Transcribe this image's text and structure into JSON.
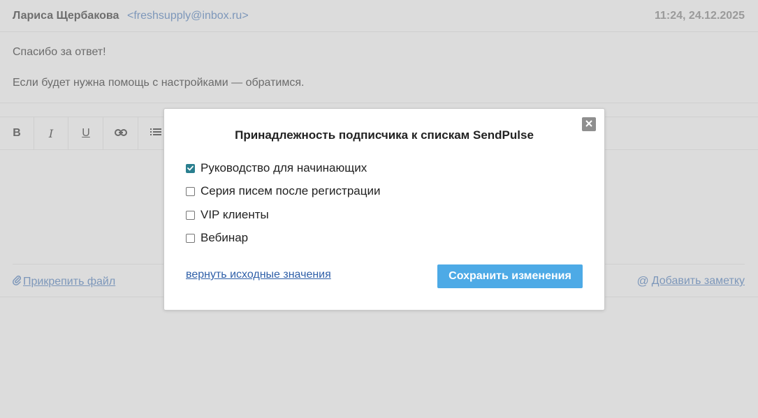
{
  "message": {
    "sender_name": "Лариса Щербакова",
    "sender_email": "<freshsupply@inbox.ru>",
    "datetime": "11:24, 24.12.2025",
    "body_lines": [
      "Спасибо за ответ!",
      "Если будет нужна помощь с настройками — обратимся."
    ]
  },
  "toolbar": {
    "bold": "B",
    "italic": "I",
    "underline": "U",
    "link_icon": "link-icon",
    "list_icon": "list-icon"
  },
  "footer": {
    "attach_label": "Прикрепить файл",
    "note_label": "Добавить заметку"
  },
  "modal": {
    "title": "Принадлежность подписчика к спискам SendPulse",
    "options": [
      {
        "label": "Руководство для начинающих",
        "checked": true
      },
      {
        "label": "Серия писем после регистрации",
        "checked": false
      },
      {
        "label": "VIP клиенты",
        "checked": false
      },
      {
        "label": "Вебинар",
        "checked": false
      }
    ],
    "reset_label": "вернуть исходные значения",
    "save_label": "Сохранить изменения",
    "close_icon": "close-icon"
  },
  "colors": {
    "background": "#dcdcdc",
    "link": "#7d97ba",
    "checkbox_checked": "#2a7f8f",
    "save_button": "#4daae6"
  }
}
